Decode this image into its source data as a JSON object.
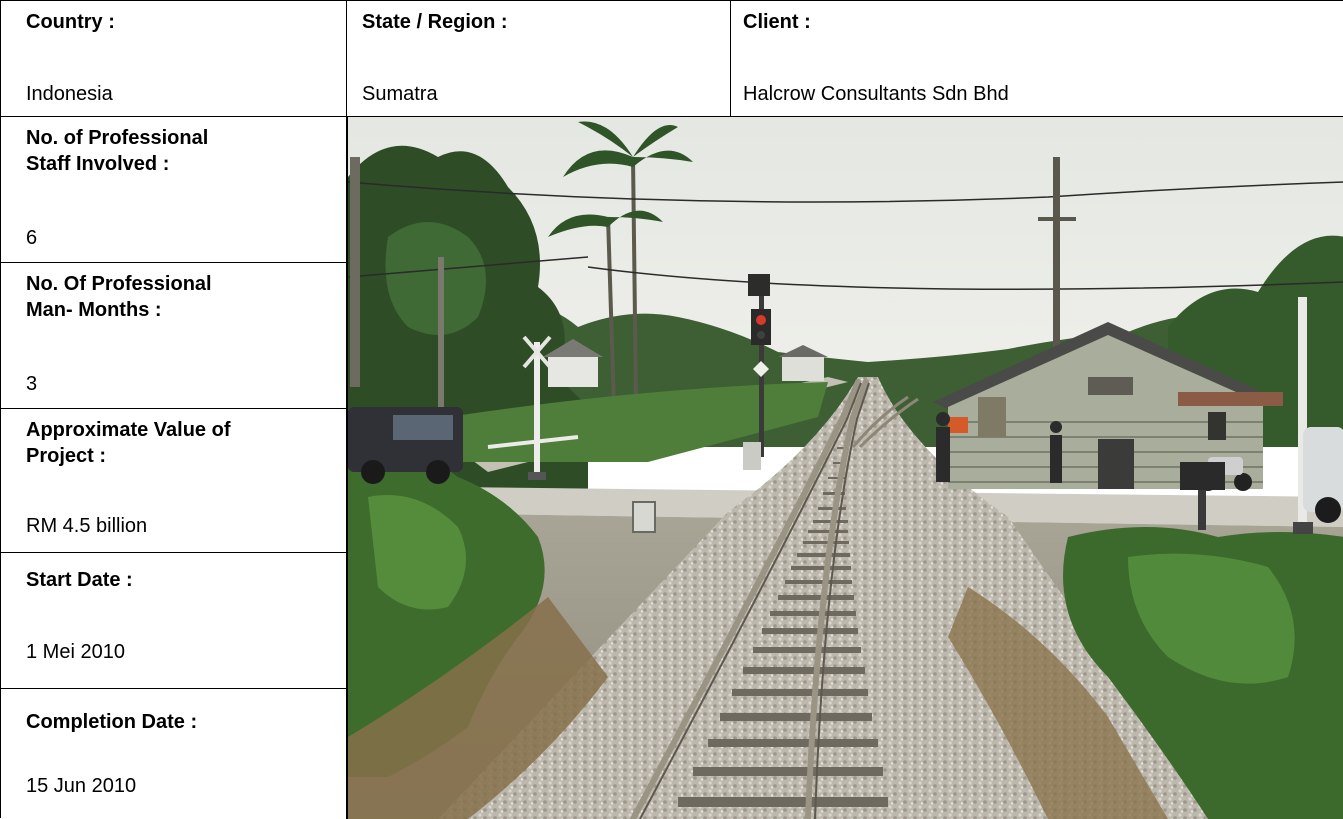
{
  "project_sheet": {
    "country": {
      "label": "Country :",
      "value": "Indonesia"
    },
    "state_region": {
      "label": "State / Region :",
      "value": "Sumatra"
    },
    "client": {
      "label": "Client :",
      "value": "Halcrow Consultants Sdn  Bhd"
    },
    "professional_staff": {
      "label": "No. of Professional\nStaff Involved :",
      "value": "6"
    },
    "man_months": {
      "label": "No. Of Professional\nMan- Months :",
      "value": "3"
    },
    "project_value": {
      "label": "Approximate Value of\nProject :",
      "value": "RM 4.5 billion"
    },
    "start_date": {
      "label": "Start Date :",
      "value": "1 Mei 2010"
    },
    "completion_date": {
      "label": "Completion Date :",
      "value": "15 Jun 2010"
    }
  },
  "photo": {
    "subject": "railway-level-crossing",
    "colors": {
      "sky": "#e9ebe6",
      "vegetation": "#3f6e33",
      "ballast": "#b8b3a8",
      "rail": "#8d8778",
      "road": "#cfcdc4"
    }
  }
}
